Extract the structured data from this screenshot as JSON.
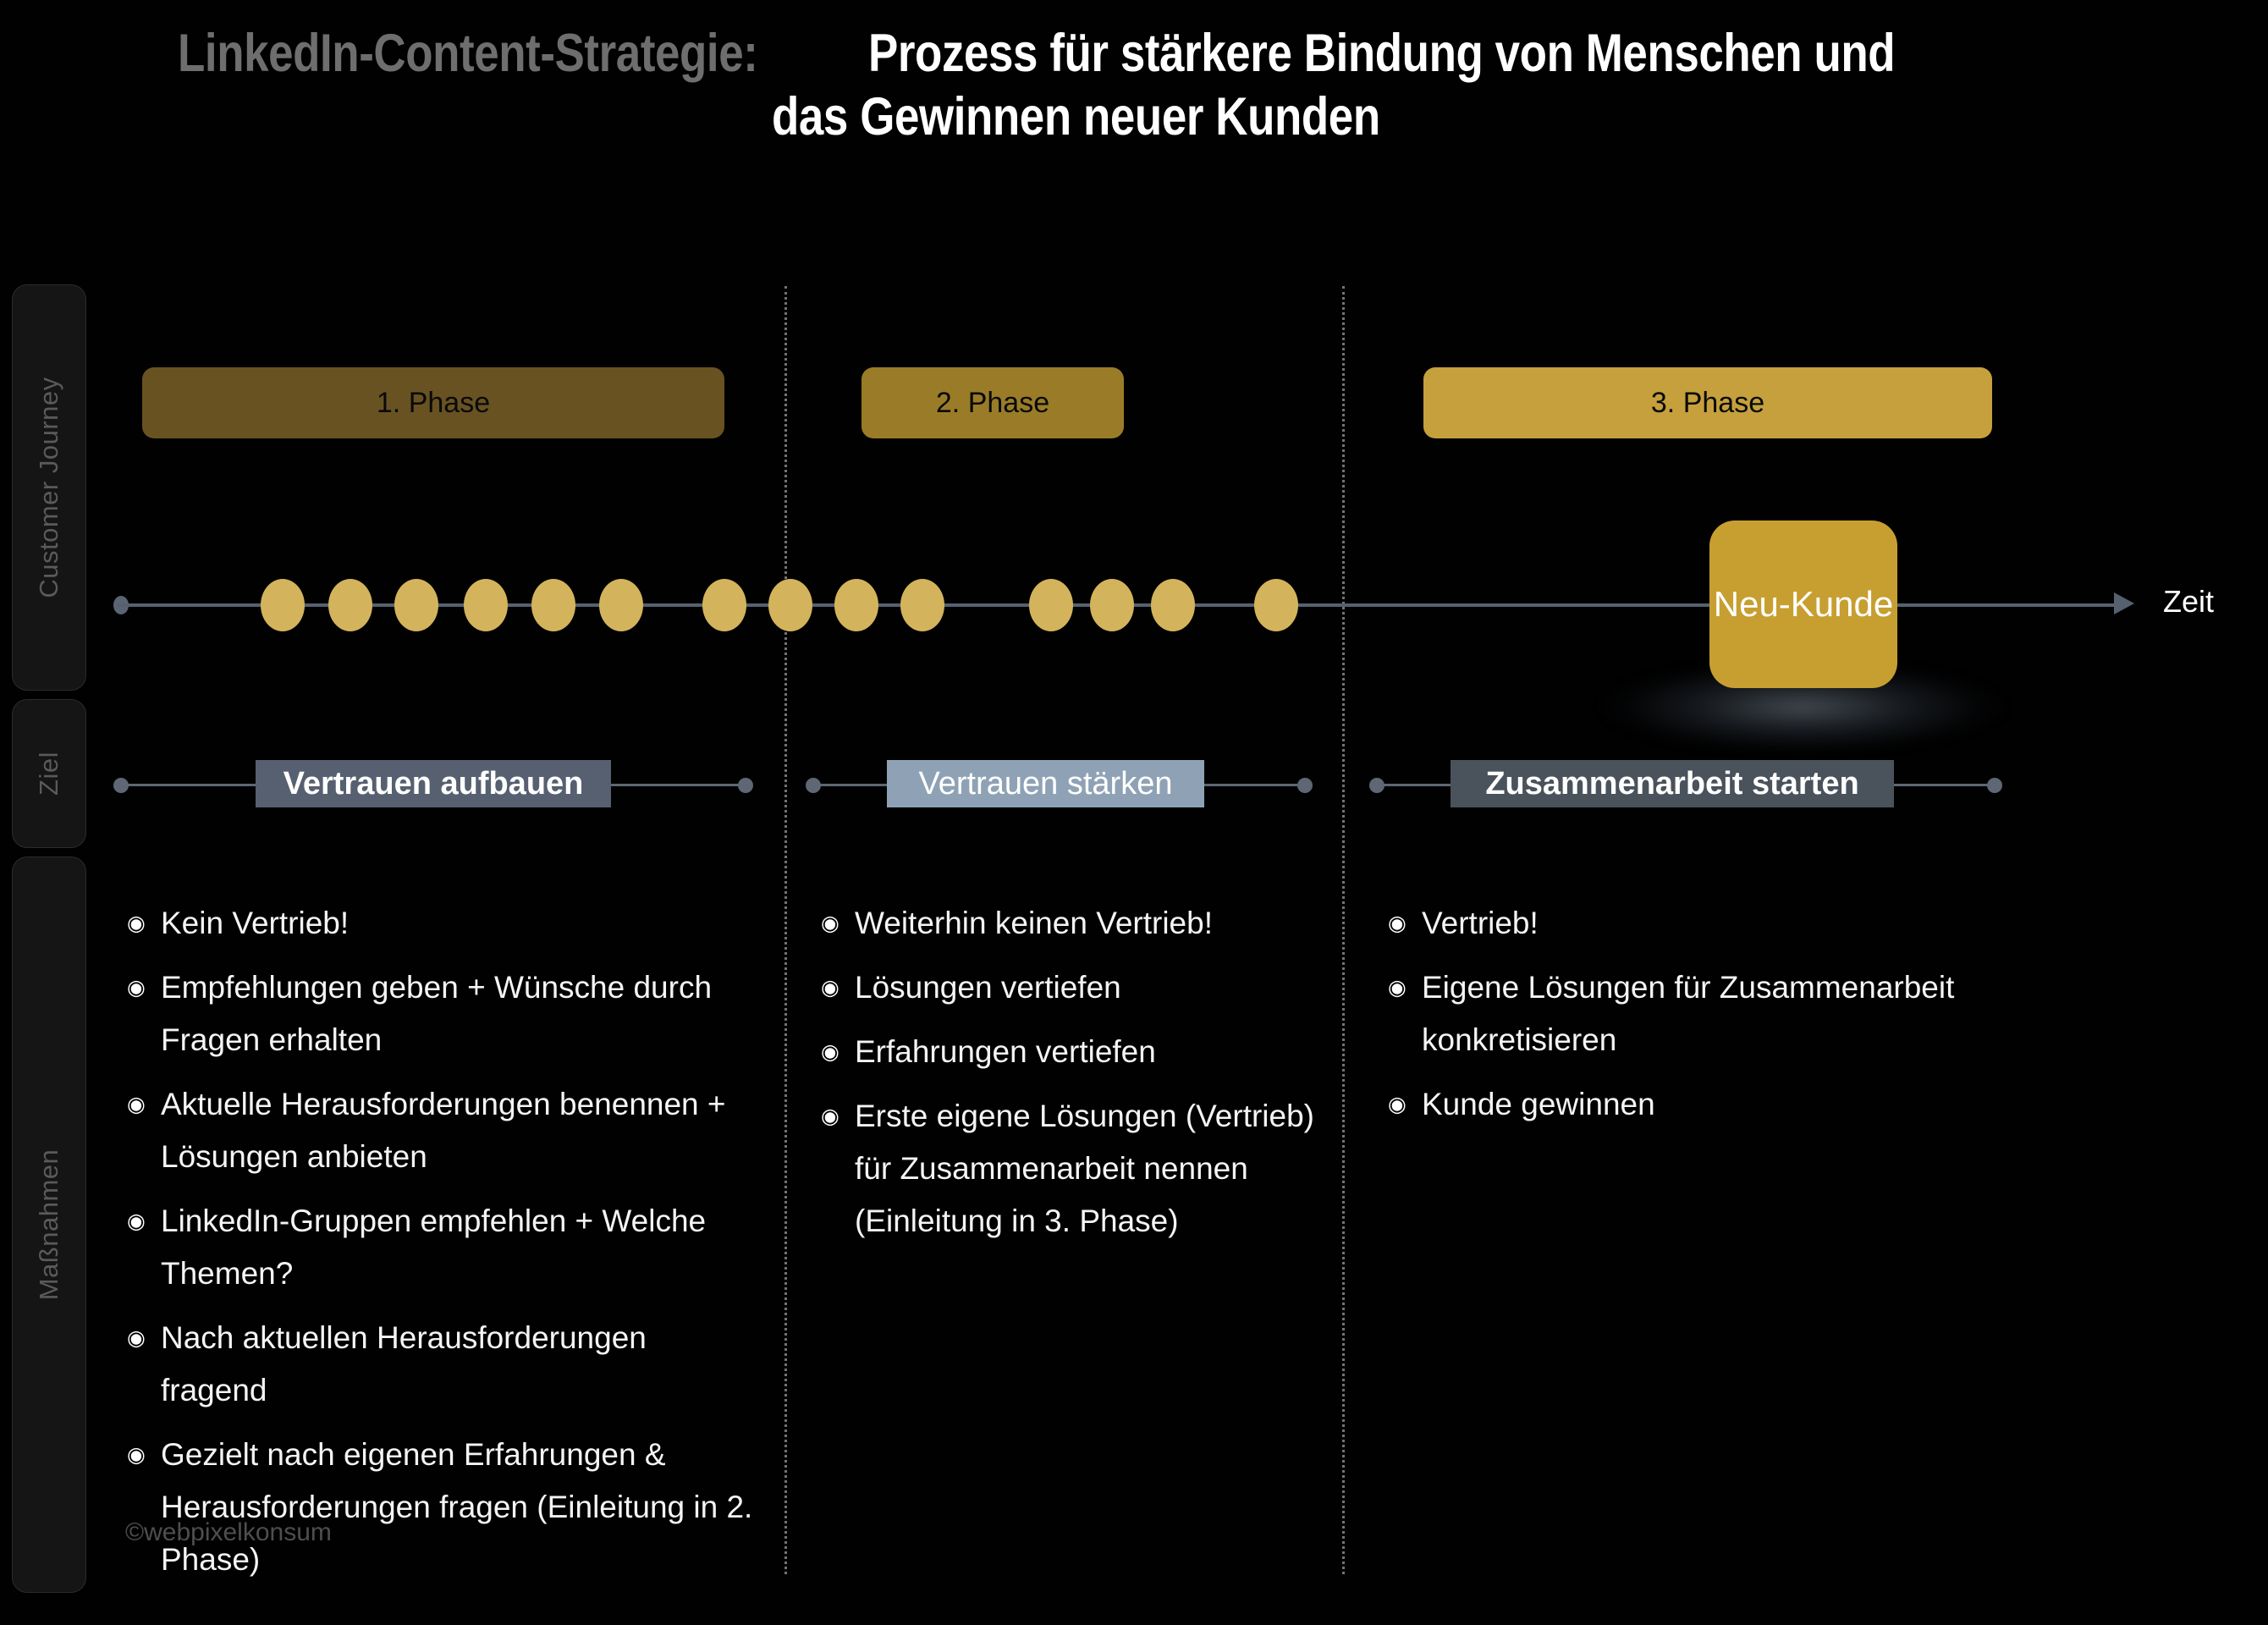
{
  "title": {
    "prefix": "LinkedIn-Content-Strategie:",
    "main_line1": "Prozess für stärkere Bindung von Menschen und",
    "main_line2": "das Gewinnen neuer Kunden"
  },
  "rails": [
    {
      "key": "journey",
      "label": "Customer Journey"
    },
    {
      "key": "ziel",
      "label": "Ziel"
    },
    {
      "key": "massnahmen",
      "label": "Maßnahmen"
    }
  ],
  "phases": [
    {
      "label": "1. Phase",
      "color": "#695222"
    },
    {
      "label": "2. Phase",
      "color": "#9a7c28"
    },
    {
      "label": "3. Phase",
      "color": "#c5a03c"
    }
  ],
  "timeline": {
    "axis_label": "Zeit",
    "node_label": "Neu-Kunde",
    "node_color": "#c79f31",
    "dot_color": "#d3b45c",
    "axis_color": "#566170",
    "dot_positions": [
      170,
      250,
      328,
      410,
      490,
      570,
      692,
      770,
      848,
      926,
      1078,
      1150,
      1222,
      1344
    ],
    "dot_count": 14
  },
  "goals": [
    {
      "label": "Vertrauen aufbauen",
      "color": "#566070",
      "style": "narrow"
    },
    {
      "label": "Vertrauen stärken",
      "color": "#8fa2b5",
      "style": "regular"
    },
    {
      "label": "Zusammenarbeit starten",
      "color": "#4a525c",
      "style": "narrow"
    }
  ],
  "measures": [
    {
      "phase": "1. Phase",
      "bullet": "◉",
      "items": [
        "Kein Vertrieb!",
        "Empfehlungen geben + Wünsche durch Fragen erhalten",
        "Aktuelle Herausforderungen benennen + Lösungen anbieten",
        "LinkedIn-Gruppen empfehlen + Welche Themen?",
        "Nach aktuellen Herausforderungen fragend",
        "Gezielt nach eigenen Erfahrungen & Herausforderungen fragen (Einleitung in 2. Phase)"
      ]
    },
    {
      "phase": "2. Phase",
      "bullet": "◉",
      "items": [
        "Weiterhin keinen Vertrieb!",
        "Lösungen vertiefen",
        "Erfahrungen vertiefen",
        "Erste eigene Lösungen (Vertrieb) für Zusammenarbeit nennen (Einleitung in 3. Phase)"
      ]
    },
    {
      "phase": "3. Phase",
      "bullet": "◉",
      "items": [
        "Vertrieb!",
        "Eigene Lösungen für Zusammenarbeit konkretisieren",
        "Kunde gewinnen"
      ]
    }
  ],
  "footer": {
    "copyright": "©webpixelkonsum"
  }
}
